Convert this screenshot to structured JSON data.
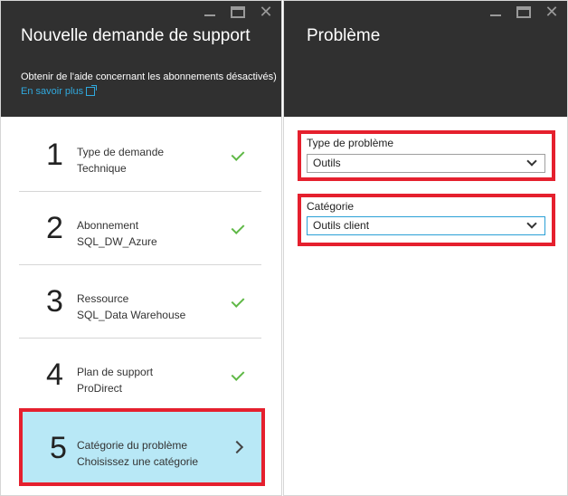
{
  "left_blade": {
    "title": "Nouvelle demande de support",
    "subtitle": "Obtenir de l'aide concernant les abonnements désactivés)",
    "link": "En savoir plus",
    "steps": [
      {
        "num": "1",
        "label": "Type de demande",
        "value": "Technique"
      },
      {
        "num": "2",
        "label": "Abonnement",
        "value": "SQL_DW_Azure"
      },
      {
        "num": "3",
        "label": "Ressource",
        "value": "SQL_Data Warehouse"
      },
      {
        "num": "4",
        "label": "Plan de support",
        "value": "ProDirect"
      },
      {
        "num": "5",
        "label": "Catégorie du problème",
        "value": "Choisissez une catégorie"
      }
    ]
  },
  "right_blade": {
    "title": "Problème",
    "problem_type": {
      "label": "Type de problème",
      "value": "Outils"
    },
    "category": {
      "label": "Catégorie",
      "value": "Outils client"
    }
  },
  "colors": {
    "header": "#303030",
    "highlight": "#e5202e",
    "active_step": "#b8e8f6",
    "check": "#5fb846",
    "link": "#30a9de"
  }
}
